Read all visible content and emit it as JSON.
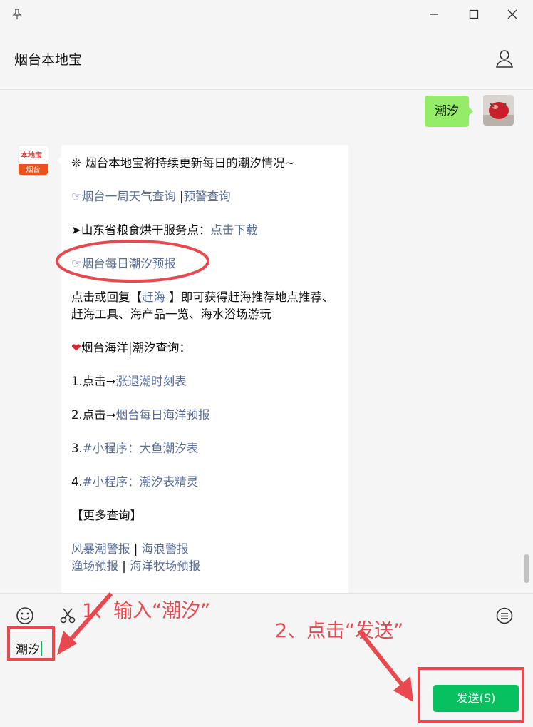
{
  "window": {
    "pin_icon": "pin-icon",
    "minimize_icon": "minimize-icon",
    "maximize_icon": "maximize-icon",
    "close_icon": "close-icon"
  },
  "header": {
    "title": "烟台本地宝",
    "profile_icon": "person-icon"
  },
  "chat": {
    "outgoing": {
      "text": "潮汐"
    },
    "bot_avatar": {
      "logo_text": "本地宝",
      "label": "烟台"
    },
    "incoming": {
      "line1": "❊ 烟台本地宝将持续更新每日的潮汐情况~",
      "weather_prefix": "☞",
      "weather_link": "烟台一周天气查询",
      "weather_sep": " |",
      "warning_link": "预警查询",
      "grain_prefix": "➤山东省粮食烘干服务点：",
      "grain_link": "点击下载",
      "tide_prefix": "☞",
      "tide_link": "烟台每日潮汐预报",
      "ganhai_pre": "点击或回复【",
      "ganhai_kw": "赶海",
      "ganhai_post": " 】即可获得赶海推荐地点推荐、赶海工具、海产品一览、海水浴场游玩",
      "ocean_heart": "❤",
      "ocean_title": "烟台海洋|潮汐查询：",
      "item1_pre": "1.点击➞",
      "item1_link": "涨退潮时刻表",
      "item2_pre": "2.点击➞",
      "item2_link": "烟台每日海洋预报",
      "item3_pre": "3.",
      "item3_link": "#小程序：大鱼潮汐表",
      "item4_pre": "4.",
      "item4_link": "#小程序：潮汐表精灵",
      "more": "【更多查询】",
      "storm_link": "风暴潮警报",
      "sep1": " | ",
      "wave_link": "海浪警报",
      "fishing_link": "渔场预报",
      "sep2": " | ",
      "ranch_link": "海洋牧场预报"
    }
  },
  "toolbar": {
    "emoji_icon": "emoji-icon",
    "scissors_icon": "scissors-icon",
    "history_icon": "chat-history-icon"
  },
  "input": {
    "value": "潮汐"
  },
  "send_button": {
    "label": "发送(S)"
  },
  "annotations": {
    "step1": "1、输入“潮汐”",
    "step2": "2、点击“发送”",
    "color": "#e8484e"
  },
  "colors": {
    "outgoing_bubble": "#95ec69",
    "link": "#576b95",
    "send_button": "#07c160"
  }
}
